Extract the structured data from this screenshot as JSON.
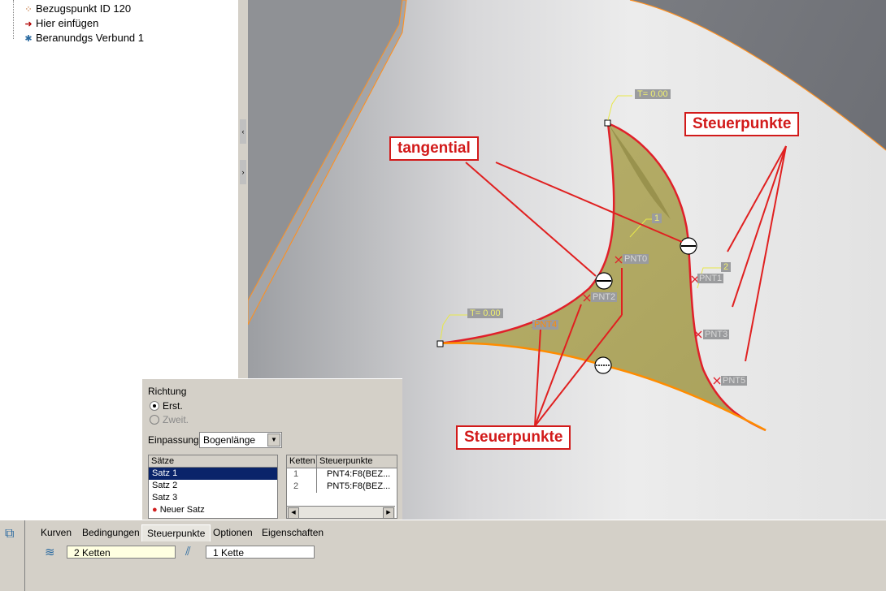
{
  "tree": {
    "items": [
      {
        "label": "Bezugspunkt ID 120",
        "icon": "datum-point-icon"
      },
      {
        "label": "Hier einfügen",
        "icon": "insert-here-arrow-icon"
      },
      {
        "label": "Beranundgs Verbund 1",
        "icon": "boundary-blend-icon"
      }
    ]
  },
  "viewport": {
    "tags": {
      "t_top": "T= 0.00",
      "t_left": "T= 0.00",
      "num_1": "1",
      "num_2": "2",
      "pnt0": "PNT0",
      "pnt1": "PNT1",
      "pnt2": "PNT2",
      "pnt3": "PNT3",
      "pnt4": "PNT4",
      "pnt5": "PNT5"
    },
    "callouts": {
      "tangential": "tangential",
      "steuer_top": "Steuerpunkte",
      "steuer_bottom": "Steuerpunkte"
    }
  },
  "panel": {
    "direction_label": "Richtung",
    "opt_first": "Erst.",
    "opt_second": "Zweit.",
    "fit_label": "Einpassung",
    "fit_value": "Bogenlänge",
    "sets_header": "Sätze",
    "sets": [
      "Satz 1",
      "Satz 2",
      "Satz 3",
      "Neuer Satz"
    ],
    "chains_header": "Ketten",
    "points_header": "Steuerpunkte",
    "chain_rows": [
      {
        "chain": "1",
        "points": "PNT4:F8(BEZ..."
      },
      {
        "chain": "2",
        "points": "PNT5:F8(BEZ..."
      }
    ]
  },
  "dashboard": {
    "tabs": [
      "Kurven",
      "Bedingungen",
      "Steuerpunkte",
      "Optionen",
      "Eigenschaften"
    ],
    "active_tab": "Steuerpunkte",
    "field1": "2 Ketten",
    "field2": "1 Kette"
  },
  "colors": {
    "surface": "#b5ad63",
    "edge_red": "#e0202a",
    "edge_orange": "#ff8c00",
    "callout_red": "#d21a1a",
    "selection_blue": "#0a246a"
  }
}
